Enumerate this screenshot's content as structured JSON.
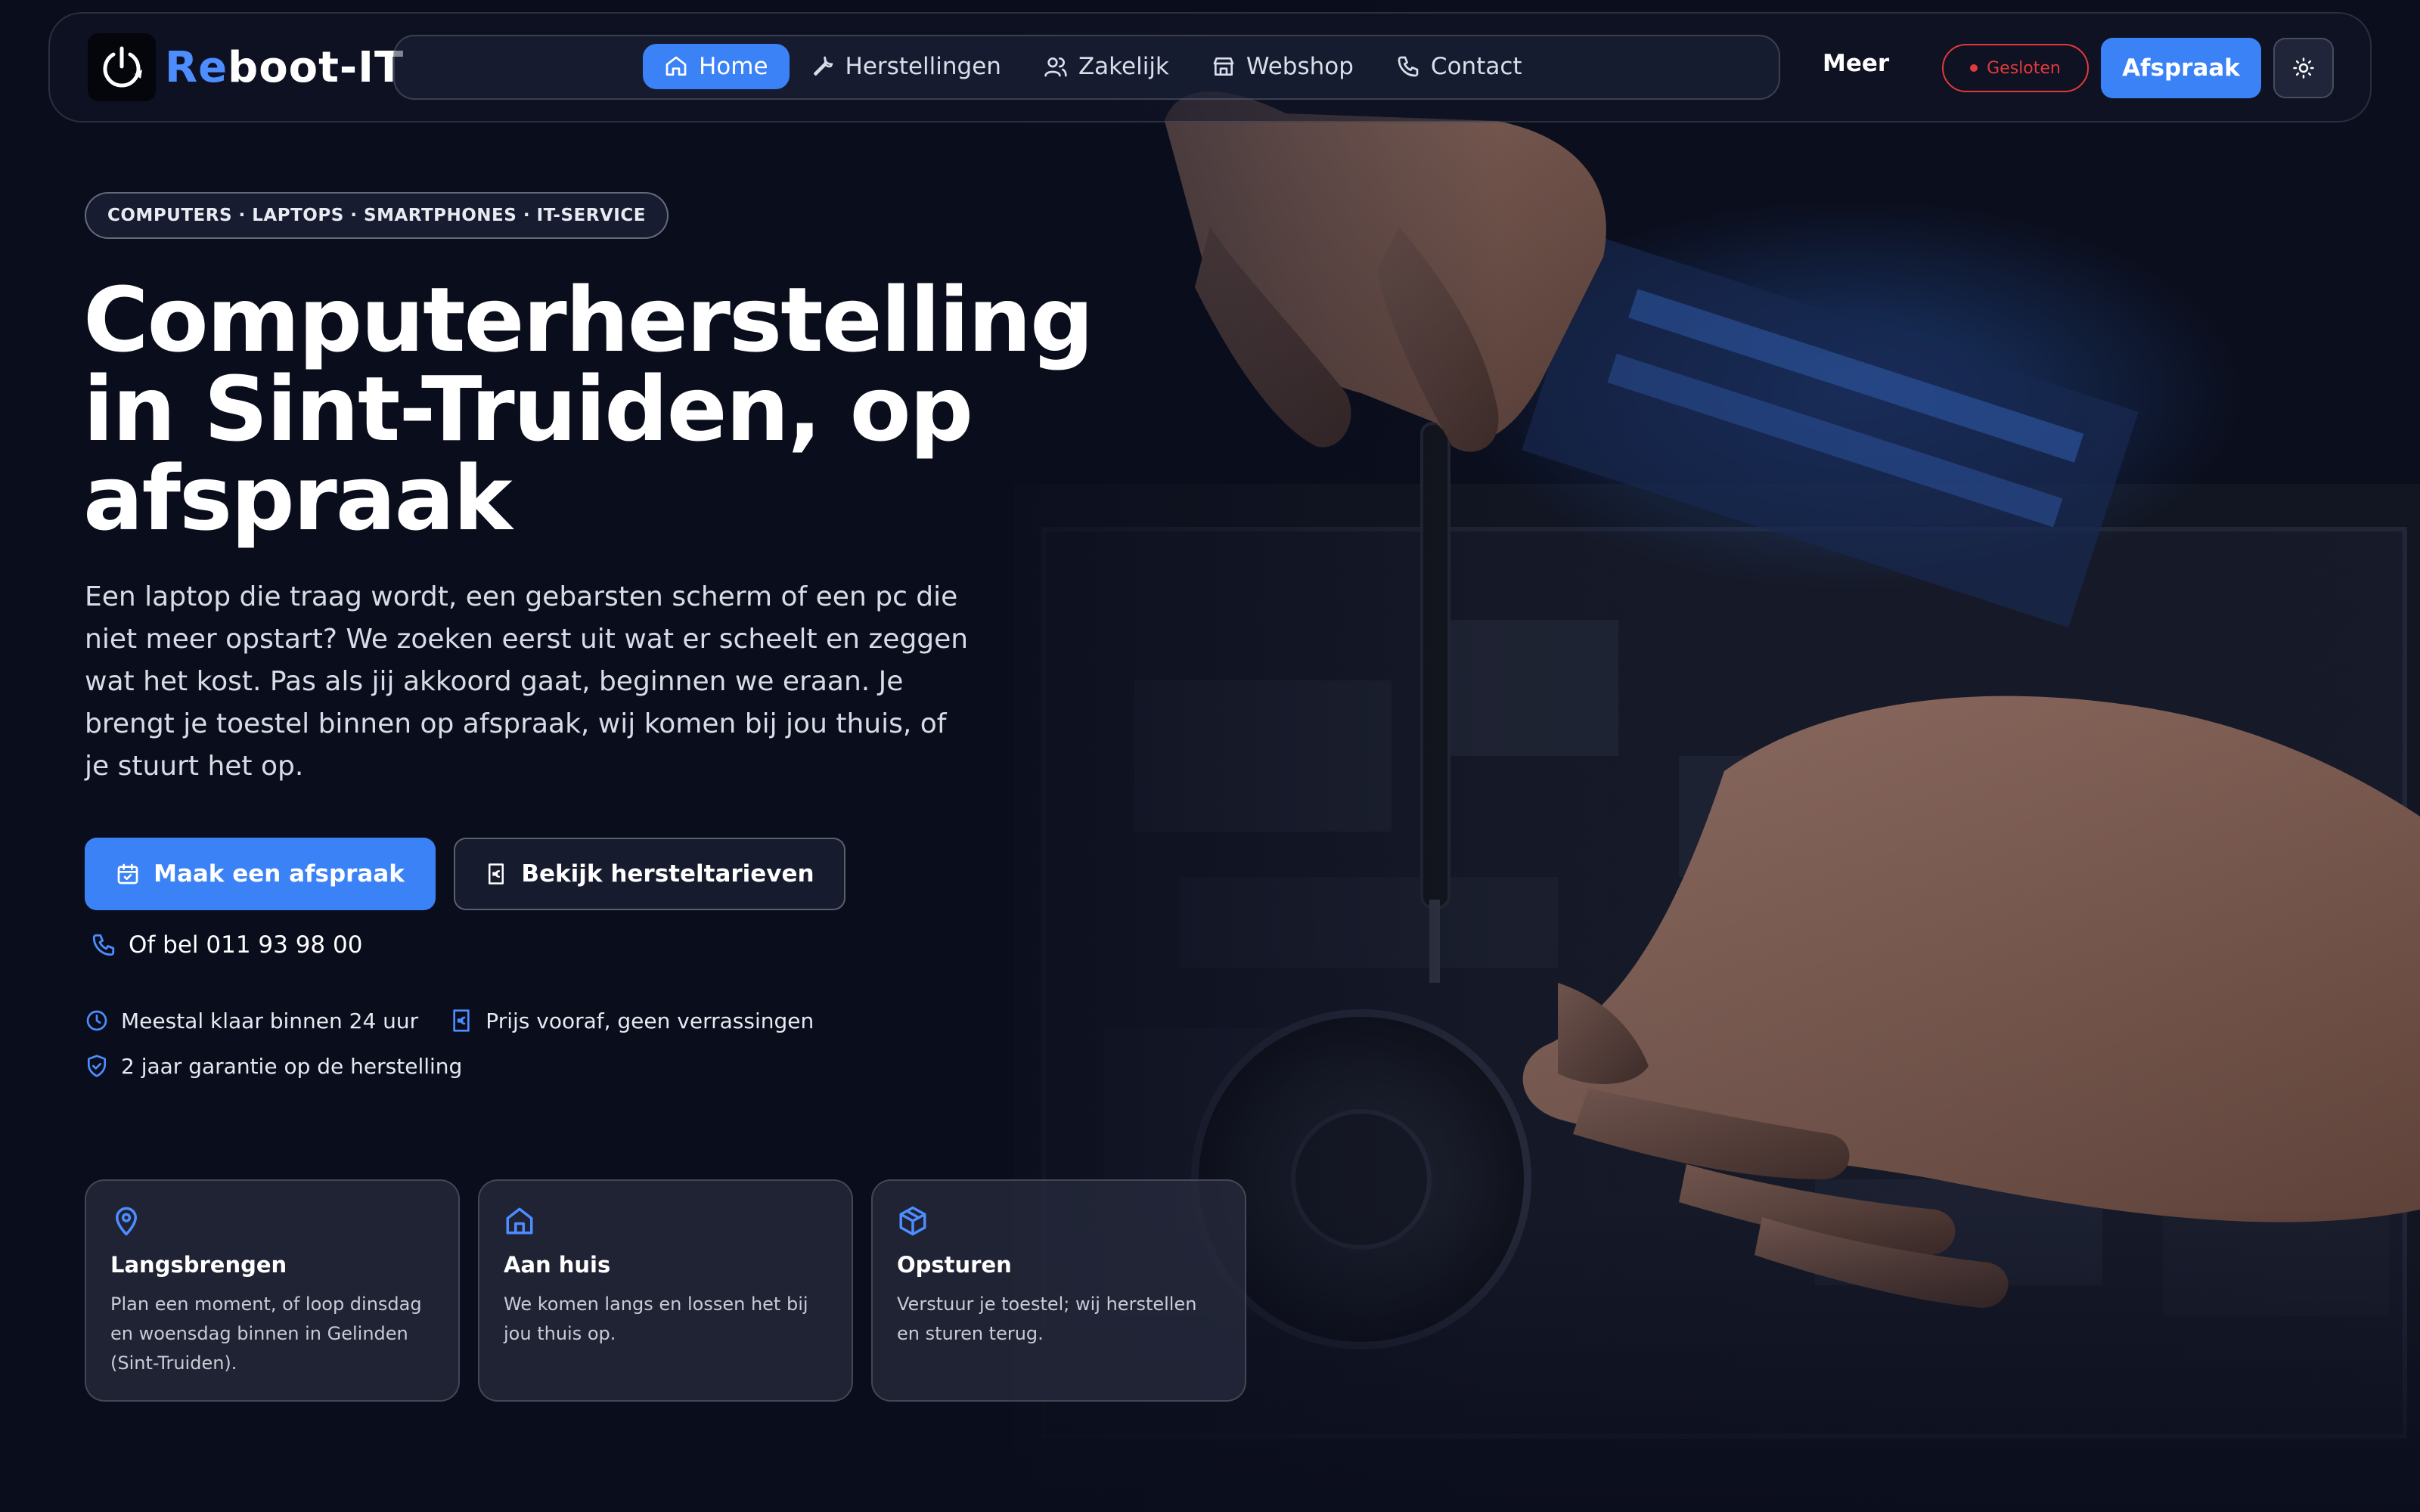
{
  "brand": {
    "logo_accent": "Re",
    "logo_rest": "boot-IT",
    "accent_color": "#3b82f6"
  },
  "nav": {
    "items": [
      {
        "label": "Home",
        "icon": "home-icon",
        "active": true
      },
      {
        "label": "Herstellingen",
        "icon": "wrench-icon",
        "active": false
      },
      {
        "label": "Zakelijk",
        "icon": "users-icon",
        "active": false
      },
      {
        "label": "Webshop",
        "icon": "store-icon",
        "active": false
      },
      {
        "label": "Contact",
        "icon": "phone-icon",
        "active": false
      }
    ],
    "more_label": "Meer",
    "status_label": "Gesloten",
    "status_color": "#e23a3a",
    "cta_label": "Afspraak",
    "theme_icon": "sun-icon"
  },
  "hero": {
    "eyebrow": "COMPUTERS · LAPTOPS · SMARTPHONES · IT-SERVICE",
    "headline": "Computerherstelling in Sint-Truiden, op afspraak",
    "lead": "Een laptop die traag wordt, een gebarsten scherm of een pc die niet meer opstart? We zoeken eerst uit wat er scheelt en zeggen wat het kost. Pas als jij akkoord gaat, beginnen we eraan. Je brengt je toestel binnen op afspraak, wij komen bij jou thuis, of je stuurt het op.",
    "primary_button": {
      "label": "Maak een afspraak",
      "icon": "calendar-icon"
    },
    "secondary_button": {
      "label": "Bekijk hersteltarieven",
      "icon": "euro-receipt-icon"
    },
    "call_text": "Of bel 011 93 98 00",
    "features": [
      {
        "label": "Meestal klaar binnen 24 uur",
        "icon": "clock-icon"
      },
      {
        "label": "Prijs vooraf, geen verrassingen",
        "icon": "euro-receipt-icon"
      },
      {
        "label": "2 jaar garantie op de herstelling",
        "icon": "shield-check-icon"
      }
    ]
  },
  "cards": [
    {
      "title": "Langsbrengen",
      "text": "Plan een moment, of loop dinsdag en woensdag binnen in Gelinden (Sint-Truiden).",
      "icon": "map-pin-icon"
    },
    {
      "title": "Aan huis",
      "text": "We komen langs en lossen het bij jou thuis op.",
      "icon": "house-icon"
    },
    {
      "title": "Opsturen",
      "text": "Verstuur je toestel; wij herstellen en sturen terug.",
      "icon": "package-icon"
    }
  ]
}
